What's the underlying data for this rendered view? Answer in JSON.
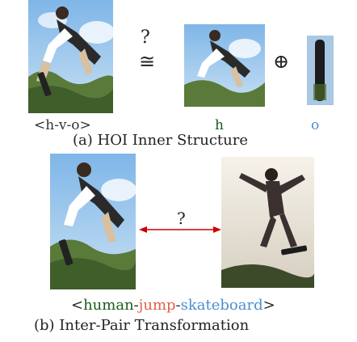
{
  "part_a": {
    "top_question": "?",
    "equiv_symbol": "≅",
    "oplus_symbol": "⊕",
    "triplet_label": "<h-v-o>",
    "h_label": "h",
    "o_label": "o",
    "caption": "(a) HOI Inner Structure"
  },
  "part_b": {
    "question": "?",
    "triplet": {
      "open": "<",
      "human": "human",
      "sep1": "-",
      "verb": "jump",
      "sep2": "-",
      "object": "skateboard",
      "close": ">"
    },
    "caption": "(b) Inter-Pair Transformation"
  },
  "colors": {
    "human": "#1a5c1a",
    "verb": "#e0604a",
    "object": "#4a8fd0",
    "bracket": "#222222",
    "arrow": "#cc0000"
  }
}
